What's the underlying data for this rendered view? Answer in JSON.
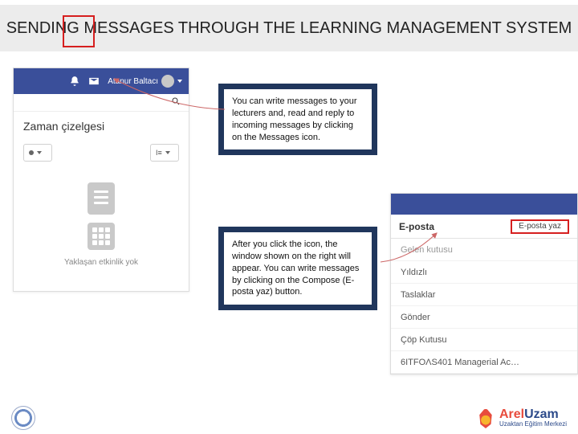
{
  "title": "SENDING MESSAGES THROUGH THE LEARNING MANAGEMENT SYSTEM",
  "lms": {
    "user_name": "Atanur Baltacı",
    "timeline_heading": "Zaman çizelgesi",
    "empty_text": "Yaklaşan etkinlik yok"
  },
  "callouts": {
    "box1": "You can write messages to your lecturers and, read and reply to incoming messages by clicking on the Messages icon.",
    "box2": "After you click the icon, the window shown on the right will appear. You can write messages by clicking on the Compose (E-posta yaz) button."
  },
  "email": {
    "title": "E-posta",
    "compose_label": "E-posta yaz",
    "items": [
      "Gelen kutusu",
      "Yıldızlı",
      "Taslaklar",
      "Gönder",
      "Çöp Kutusu",
      "6ITFOΛS401 Managerial Ac…"
    ]
  },
  "footer": {
    "brand_prefix": "Arel",
    "brand_suffix": "Uzam",
    "brand_sub": "Uzaktan Eğitim Merkezi"
  }
}
